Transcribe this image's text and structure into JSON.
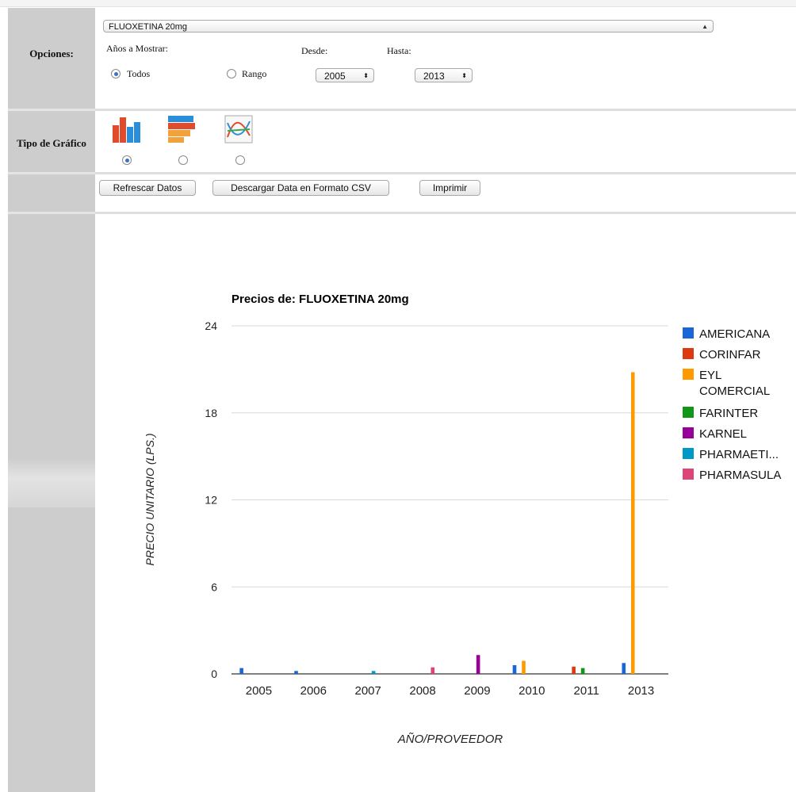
{
  "options": {
    "label": "Opciones:",
    "medicine_select": "FLUOXETINA 20mg",
    "years_label": "Años a Mostrar:",
    "all_label": "Todos",
    "range_label": "Rango",
    "from_label": "Desde:",
    "to_label": "Hasta:",
    "from_value": "2005",
    "to_value": "2013",
    "selected_mode": "Todos"
  },
  "chart_type": {
    "label": "Tipo de Gráfico",
    "options": [
      "bar-chart-icon",
      "stacked-bar-icon",
      "line-chart-icon"
    ],
    "selected_index": 0
  },
  "actions": {
    "refresh": "Refrescar Datos",
    "download": "Descargar Data en Formato CSV",
    "print": "Imprimir"
  },
  "chart_data": {
    "type": "bar",
    "title": "Precios de: FLUOXETINA 20mg",
    "xlabel": "AÑO/PROVEEDOR",
    "ylabel": "PRECIO UNITARIO (LPS.)",
    "categories": [
      "2005",
      "2006",
      "2007",
      "2008",
      "2009",
      "2010",
      "2011",
      "2013"
    ],
    "ylim": [
      0,
      24
    ],
    "yticks": [
      "0",
      "6",
      "12",
      "18",
      "24"
    ],
    "grid": true,
    "legend_position": "right",
    "series": [
      {
        "name": "AMERICANA",
        "color": "#1a66d6",
        "values": [
          0.4,
          0.2,
          null,
          null,
          null,
          0.6,
          null,
          0.75
        ]
      },
      {
        "name": "CORINFAR",
        "color": "#dc3912",
        "values": [
          null,
          null,
          null,
          null,
          null,
          null,
          0.5,
          null
        ]
      },
      {
        "name": "EYL COMERCIAL",
        "color": "#ff9900",
        "values": [
          null,
          null,
          null,
          null,
          null,
          0.9,
          null,
          20.8
        ]
      },
      {
        "name": "FARINTER",
        "color": "#109618",
        "values": [
          null,
          null,
          null,
          null,
          null,
          null,
          0.4,
          null
        ]
      },
      {
        "name": "KARNEL",
        "color": "#990099",
        "values": [
          null,
          null,
          null,
          null,
          1.3,
          null,
          null,
          null
        ]
      },
      {
        "name": "PHARMAETI...",
        "color": "#0099c6",
        "values": [
          null,
          null,
          0.2,
          null,
          null,
          null,
          null,
          null
        ]
      },
      {
        "name": "PHARMASULA",
        "color": "#dd4477",
        "values": [
          null,
          null,
          null,
          0.45,
          null,
          null,
          null,
          null
        ]
      }
    ]
  }
}
